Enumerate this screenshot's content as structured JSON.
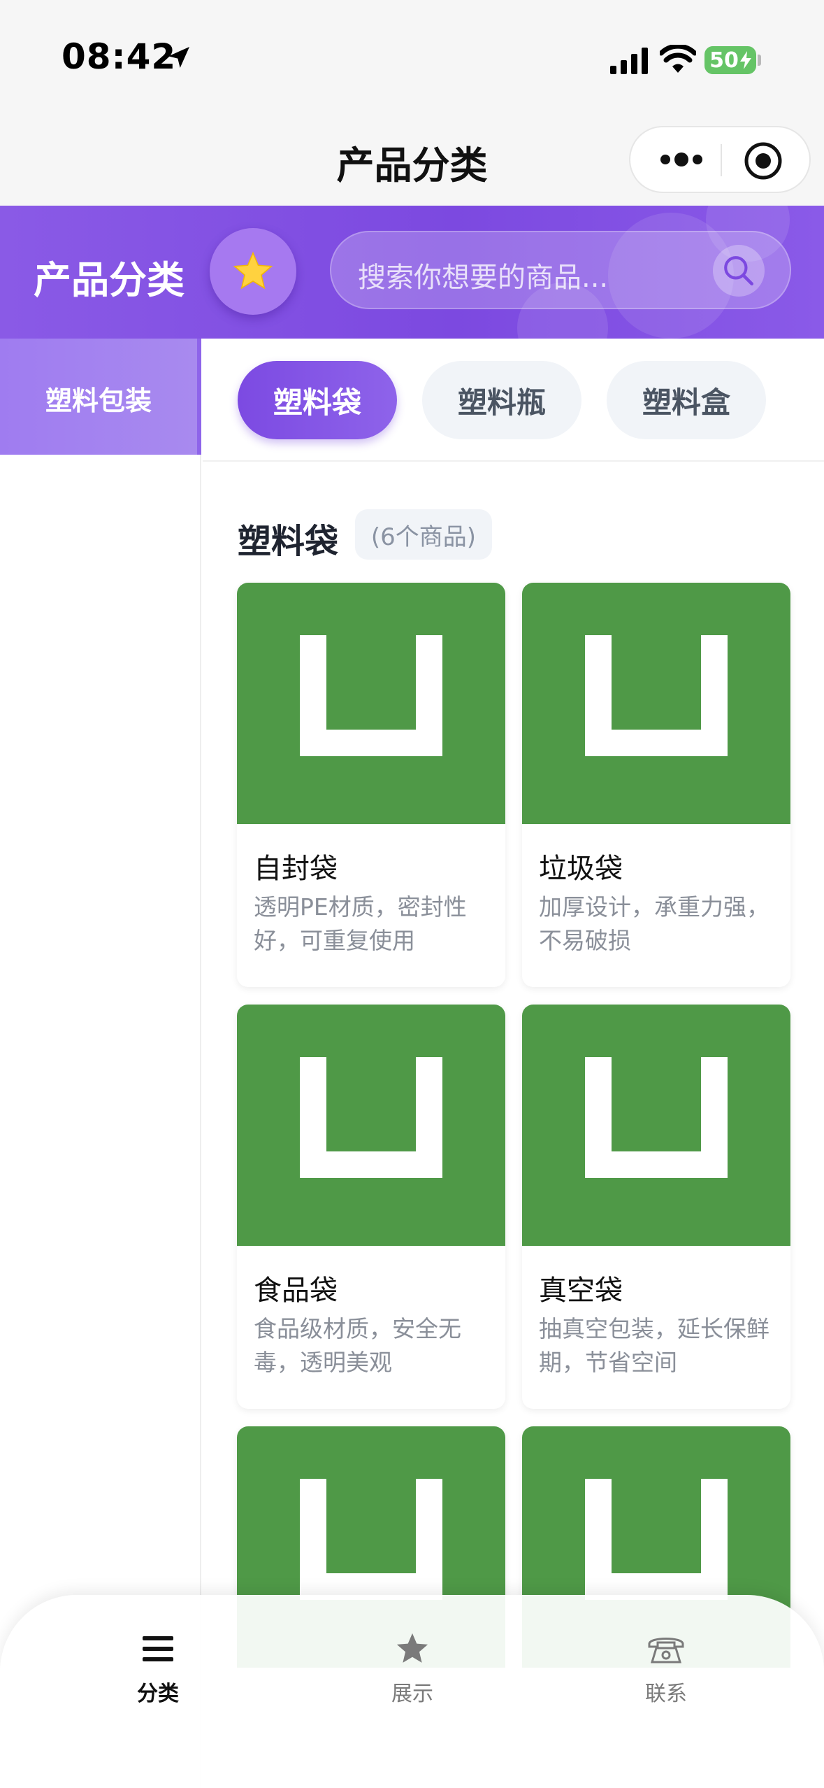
{
  "status_bar": {
    "time": "08:42",
    "battery": "50"
  },
  "nav_bar": {
    "title": "产品分类"
  },
  "header": {
    "title": "产品分类",
    "search_placeholder": "搜索你想要的商品..."
  },
  "sidebar": {
    "items": [
      {
        "label": "塑料包装",
        "active": true
      }
    ]
  },
  "tabs": [
    {
      "label": "塑料袋",
      "active": true
    },
    {
      "label": "塑料瓶",
      "active": false
    },
    {
      "label": "塑料盒",
      "active": false
    }
  ],
  "section": {
    "title": "塑料袋",
    "count": "(6个商品)"
  },
  "products": [
    {
      "name": "自封袋",
      "desc": "透明PE材质，密封性好，可重复使用"
    },
    {
      "name": "垃圾袋",
      "desc": "加厚设计，承重力强，不易破损"
    },
    {
      "name": "食品袋",
      "desc": "食品级材质，安全无毒，透明美观"
    },
    {
      "name": "真空袋",
      "desc": "抽真空包装，延长保鲜期，节省空间"
    },
    {
      "name": "",
      "desc": ""
    },
    {
      "name": "",
      "desc": ""
    }
  ],
  "bottom_nav": [
    {
      "label": "分类",
      "icon": "menu-icon",
      "active": true
    },
    {
      "label": "展示",
      "icon": "star-icon",
      "active": false
    },
    {
      "label": "联系",
      "icon": "phone-icon",
      "active": false
    }
  ],
  "colors": {
    "brand_purple": "#7c49e0",
    "product_placeholder_green": "#4f9947",
    "battery_green": "#65c466"
  }
}
